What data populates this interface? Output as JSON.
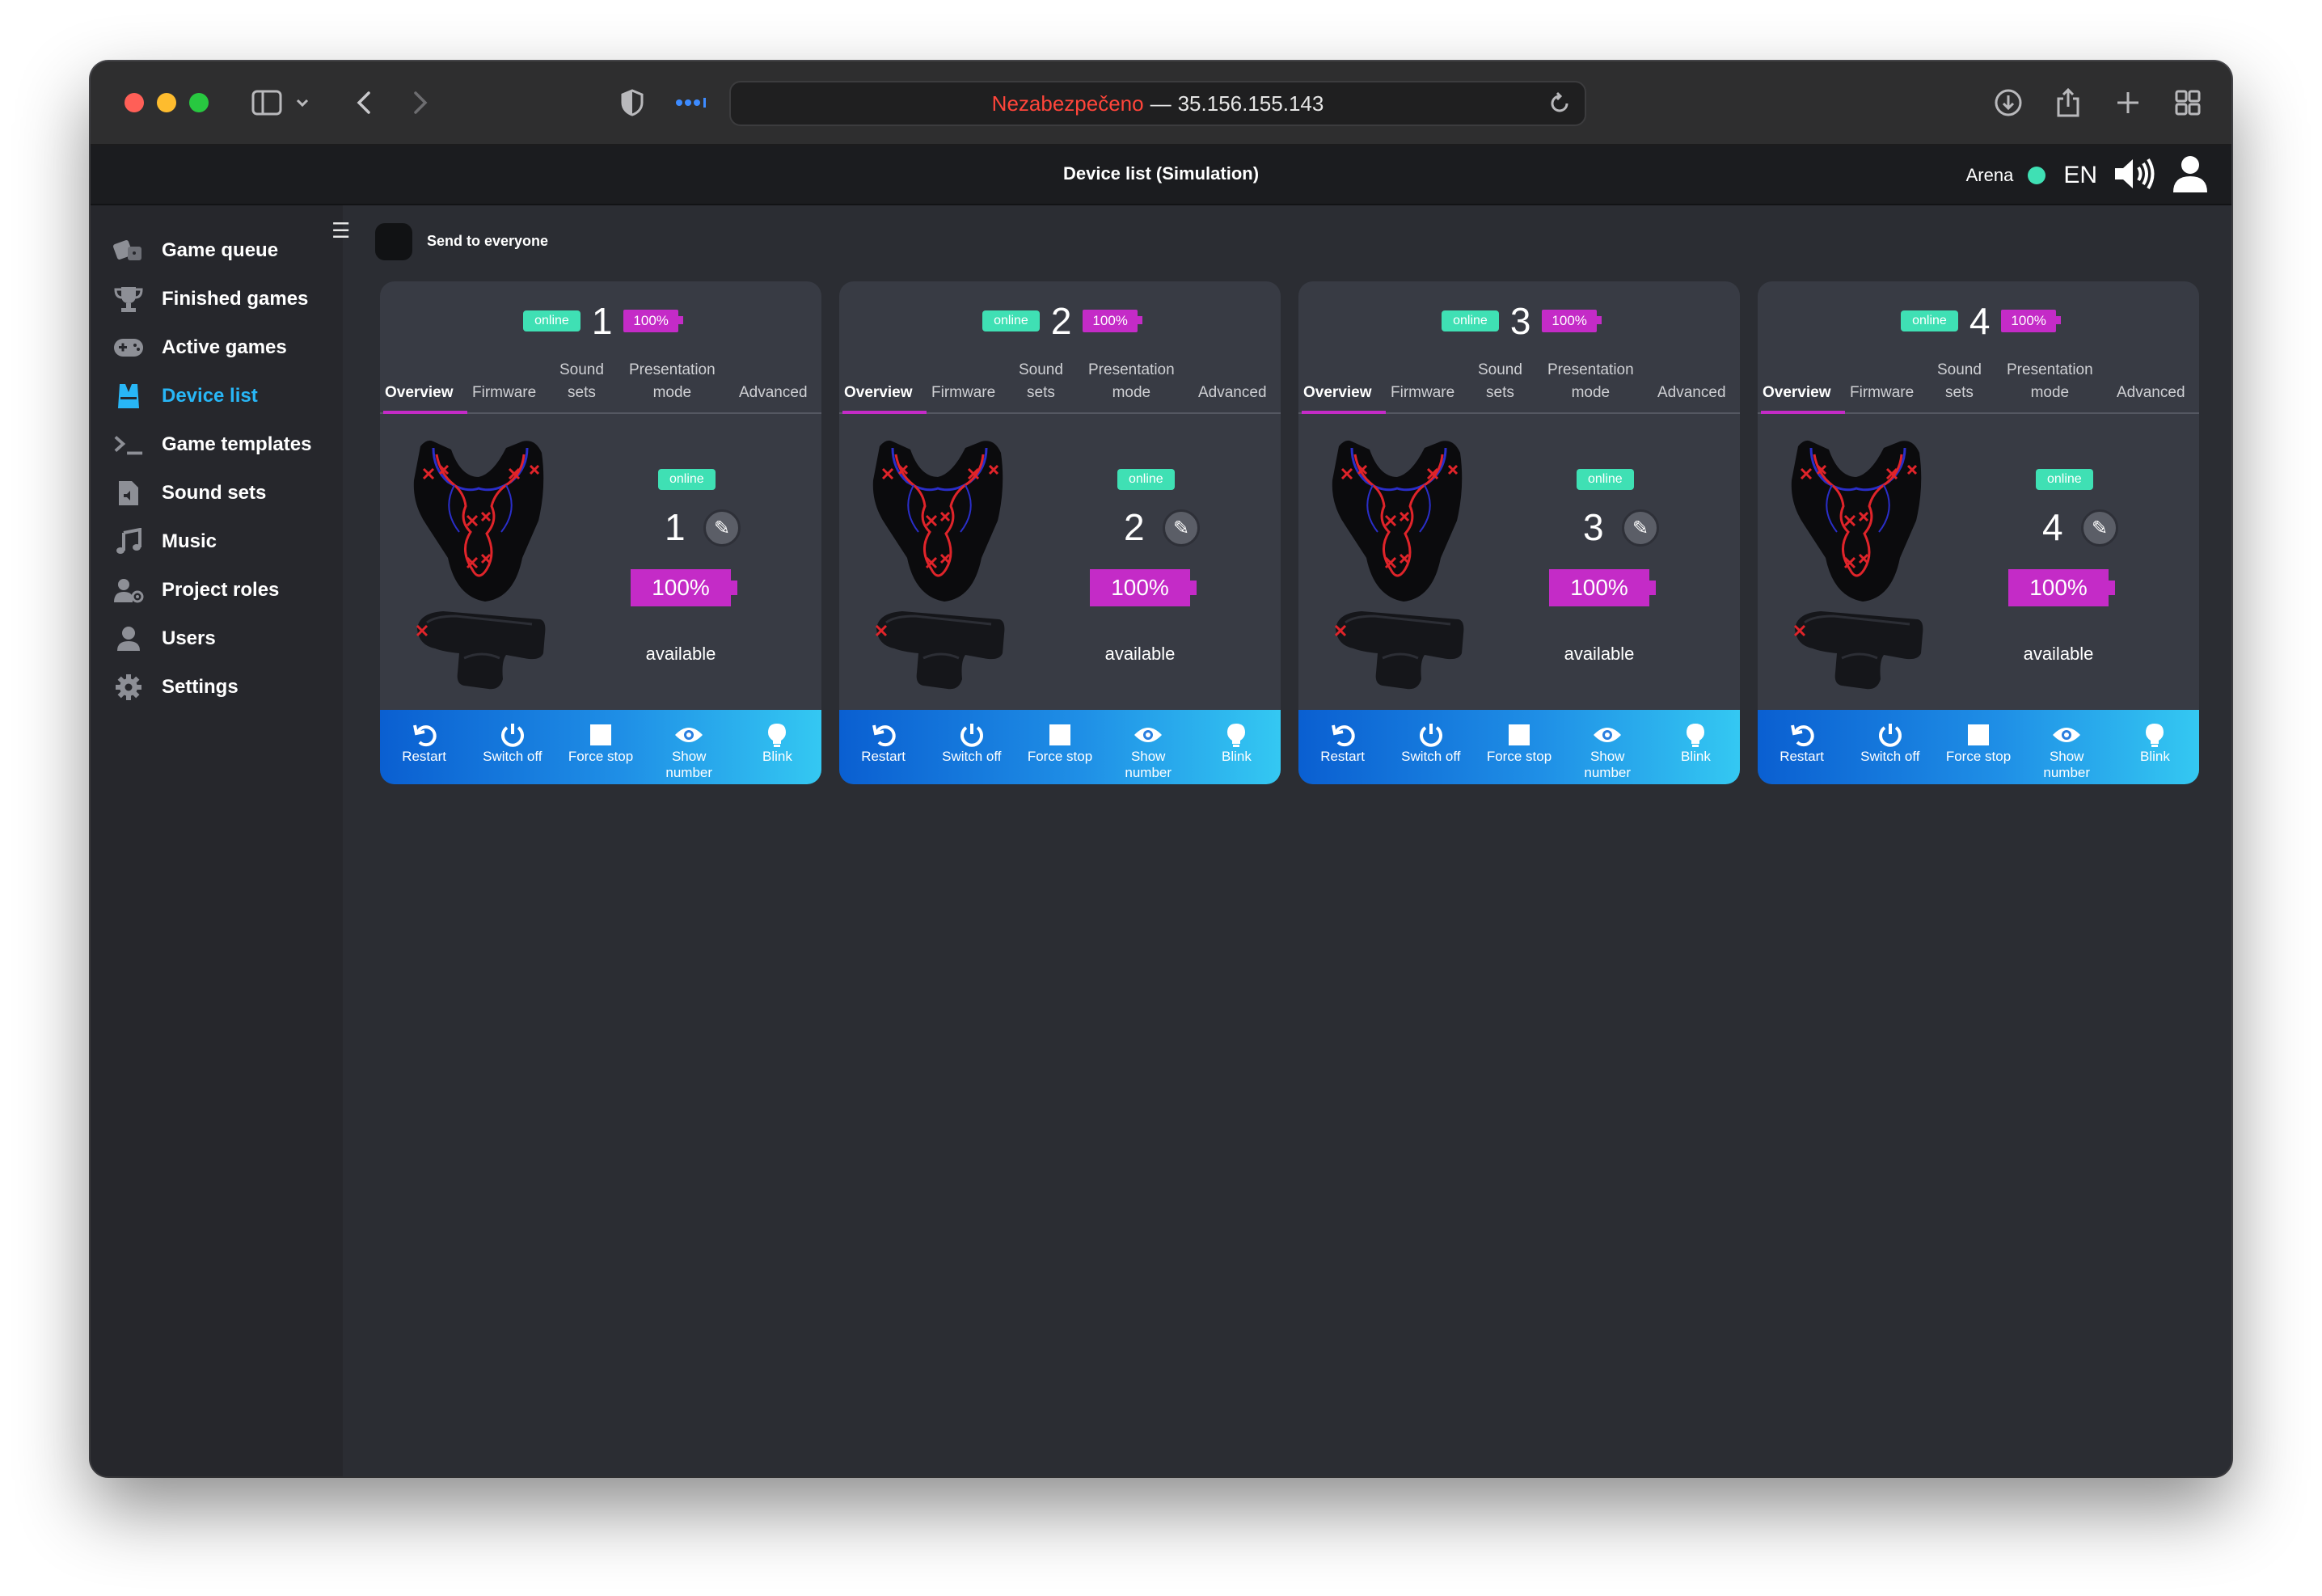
{
  "browser": {
    "url_insecure": "Nezabezpečeno",
    "url_separator": "—",
    "url_host": "35.156.155.143"
  },
  "header": {
    "title": "Device list (Simulation)",
    "arena_label": "Arena",
    "language": "EN"
  },
  "sidebar": {
    "items": [
      {
        "label": "Game queue",
        "icon": "dice-icon"
      },
      {
        "label": "Finished games",
        "icon": "trophy-icon"
      },
      {
        "label": "Active games",
        "icon": "gamepad-icon"
      },
      {
        "label": "Device list",
        "icon": "vest-icon",
        "active": true
      },
      {
        "label": "Game templates",
        "icon": "terminal-icon"
      },
      {
        "label": "Sound sets",
        "icon": "sound-file-icon"
      },
      {
        "label": "Music",
        "icon": "music-note-icon"
      },
      {
        "label": "Project roles",
        "icon": "user-gear-icon"
      },
      {
        "label": "Users",
        "icon": "user-icon"
      },
      {
        "label": "Settings",
        "icon": "gear-icon"
      }
    ]
  },
  "main": {
    "send_to_everyone": "Send to everyone"
  },
  "tabs": {
    "overview": "Overview",
    "firmware": "Firmware",
    "sound_sets_1": "Sound",
    "sound_sets_2": "sets",
    "presentation_1": "Presentation",
    "presentation_2": "mode",
    "advanced": "Advanced"
  },
  "actions": {
    "restart": "Restart",
    "switch_off": "Switch off",
    "force_stop": "Force stop",
    "show_number_1": "Show",
    "show_number_2": "number",
    "blink": "Blink"
  },
  "devices": [
    {
      "number": "1",
      "status": "online",
      "battery": "100%",
      "availability": "available"
    },
    {
      "number": "2",
      "status": "online",
      "battery": "100%",
      "availability": "available"
    },
    {
      "number": "3",
      "status": "online",
      "battery": "100%",
      "availability": "available"
    },
    {
      "number": "4",
      "status": "online",
      "battery": "100%",
      "availability": "available"
    }
  ],
  "colors": {
    "online": "#3fe0b4",
    "battery": "#c42bc7",
    "active_nav": "#28b6f6",
    "action_bar_start": "#0a5fd1",
    "action_bar_end": "#34c8f2"
  }
}
